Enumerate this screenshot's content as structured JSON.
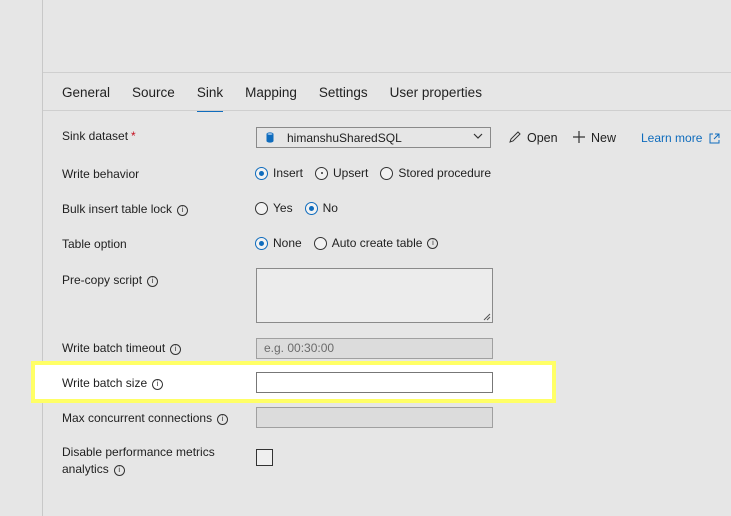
{
  "tabs": [
    {
      "label": "General"
    },
    {
      "label": "Source"
    },
    {
      "label": "Sink",
      "active": true
    },
    {
      "label": "Mapping"
    },
    {
      "label": "Settings"
    },
    {
      "label": "User properties"
    }
  ],
  "sink_dataset": {
    "label": "Sink dataset",
    "required_mark": "*",
    "value": "himanshuSharedSQL",
    "open_label": "Open",
    "new_label": "New",
    "learn_more_label": "Learn more"
  },
  "write_behavior": {
    "label": "Write behavior",
    "options": [
      "Insert",
      "Upsert",
      "Stored procedure"
    ],
    "selected": "Insert"
  },
  "bulk_insert": {
    "label": "Bulk insert table lock",
    "options": [
      "Yes",
      "No"
    ],
    "selected": "No"
  },
  "table_option": {
    "label": "Table option",
    "options": [
      "None",
      "Auto create table"
    ],
    "selected": "None"
  },
  "pre_copy_script": {
    "label": "Pre-copy script",
    "value": ""
  },
  "write_batch_timeout": {
    "label": "Write batch timeout",
    "placeholder": "e.g. 00:30:00"
  },
  "write_batch_size": {
    "label": "Write batch size",
    "value": ""
  },
  "max_concurrent": {
    "label": "Max concurrent connections",
    "value": ""
  },
  "disable_metrics": {
    "label_line1": "Disable performance metrics",
    "label_line2": "analytics",
    "checked": false
  },
  "colors": {
    "accent": "#0f6cbd",
    "highlight": "#ffff66",
    "required": "#c50f1f"
  }
}
